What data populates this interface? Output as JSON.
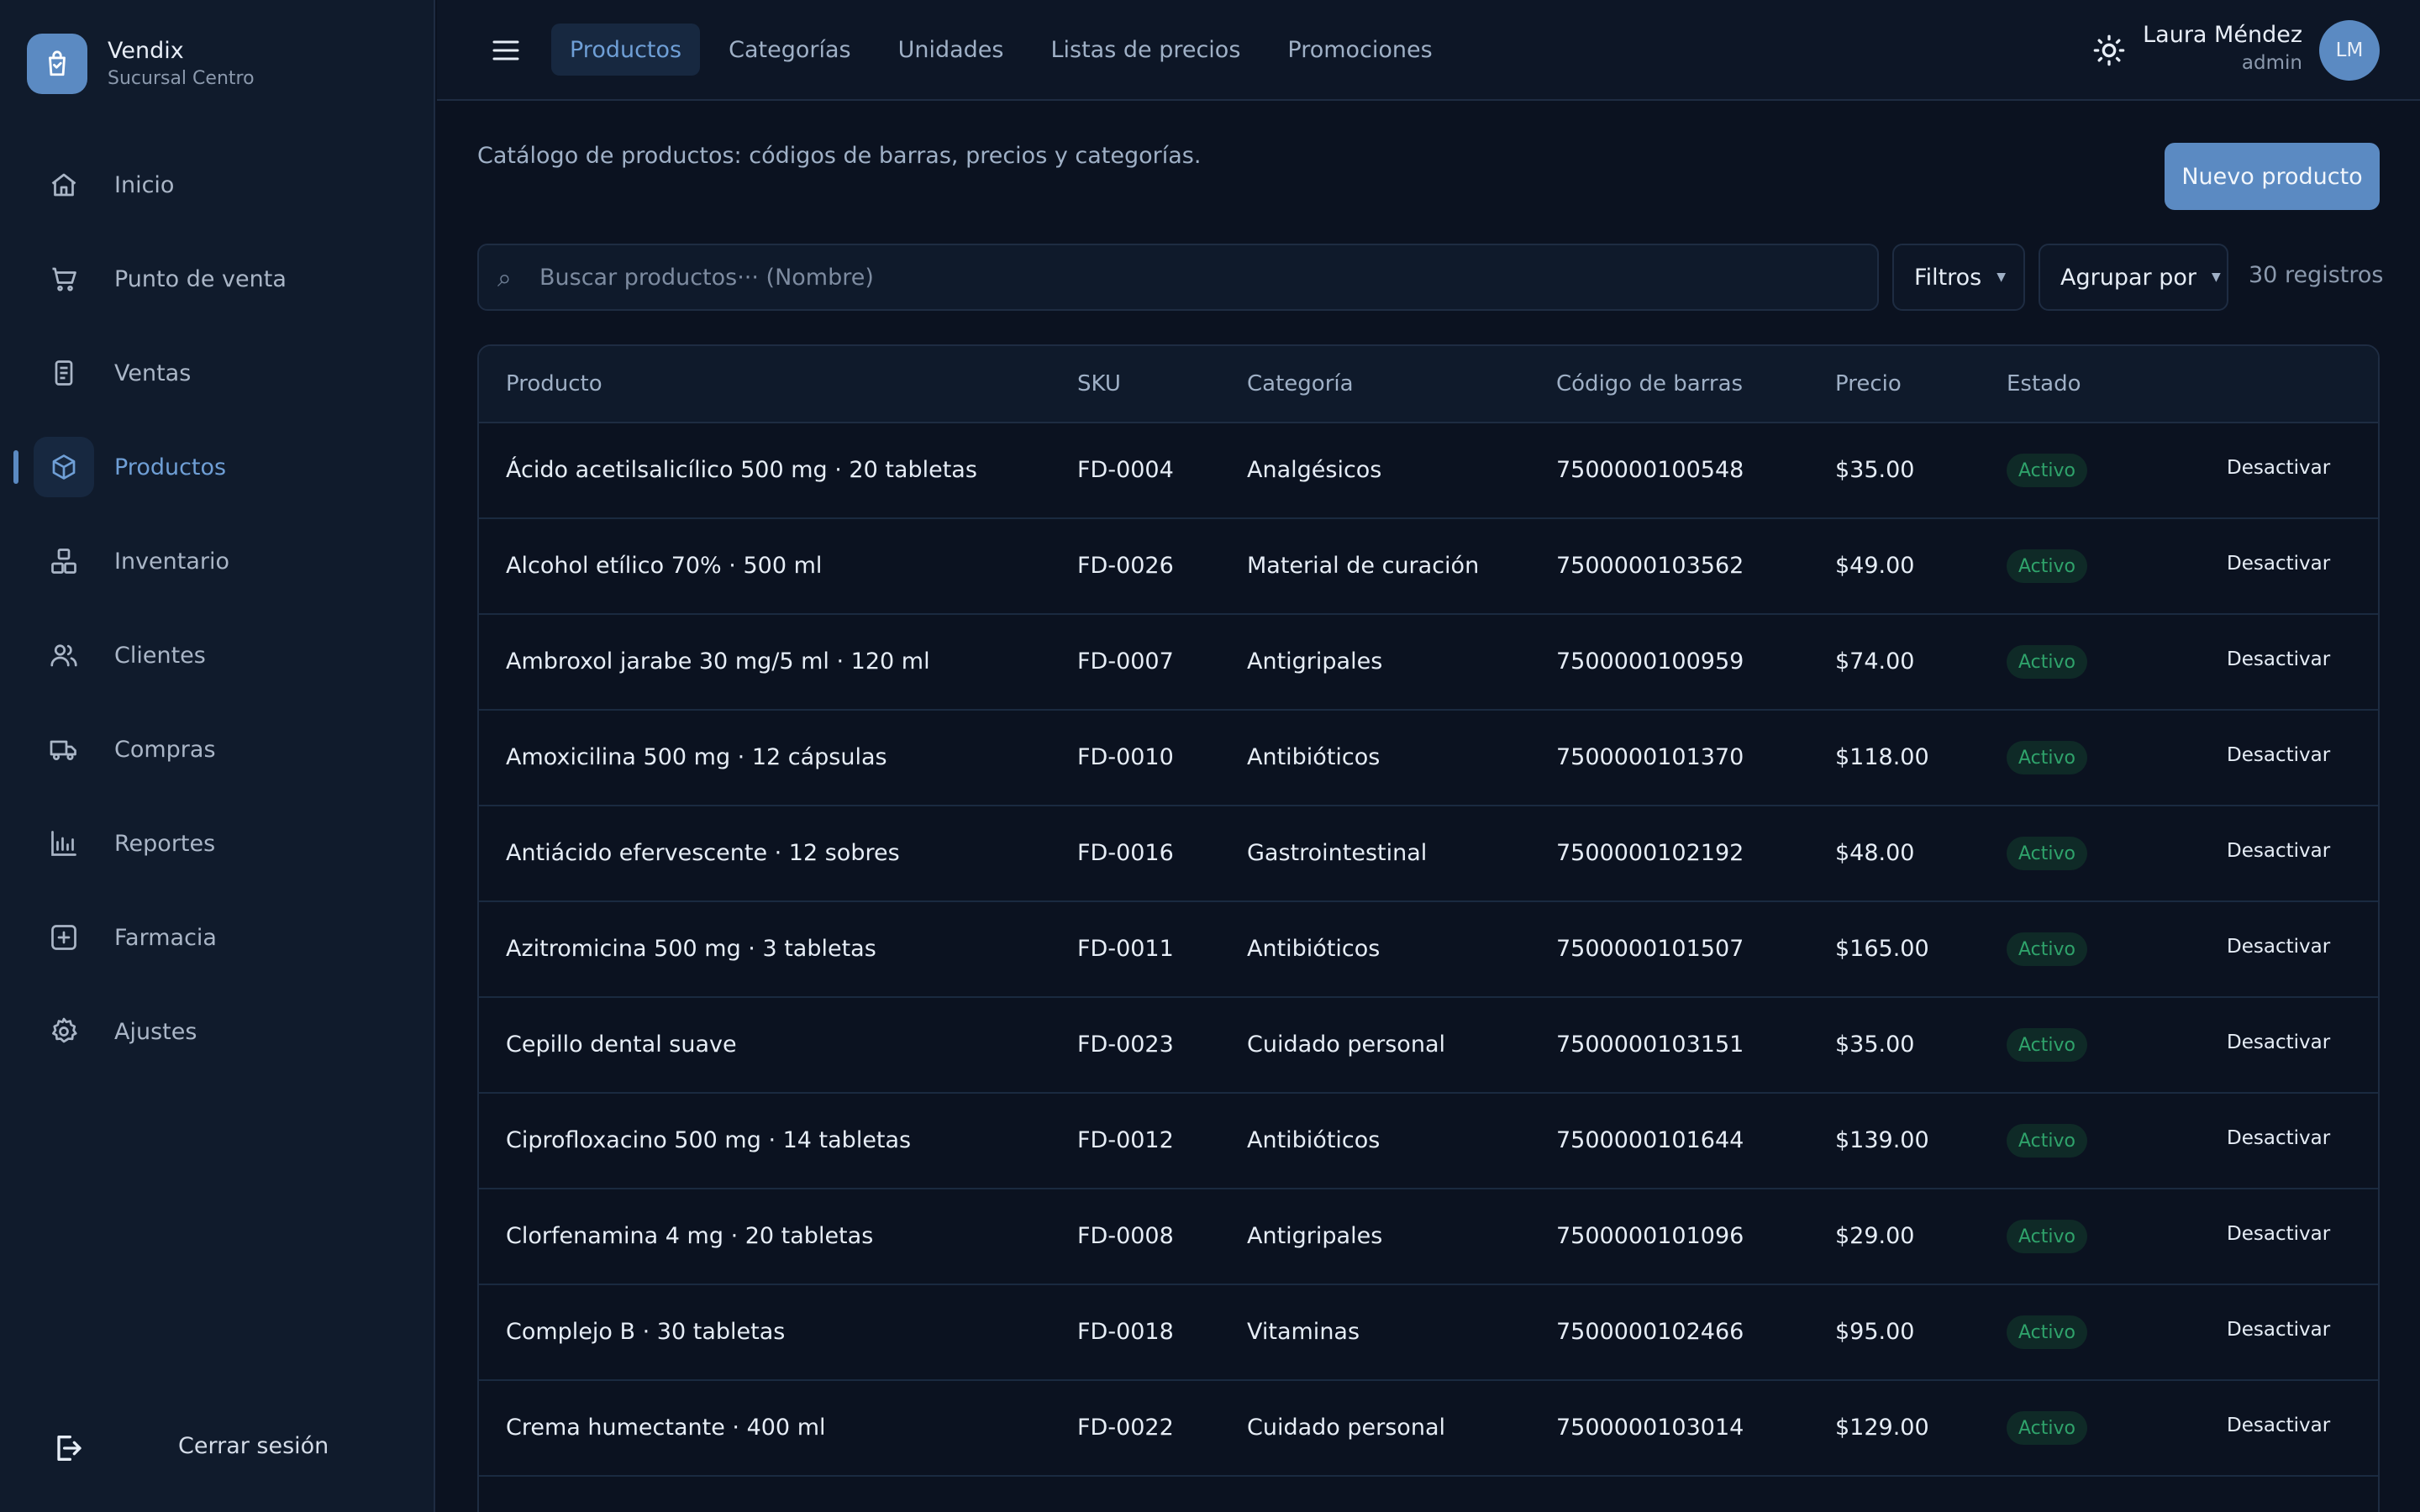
{
  "brand": {
    "name": "Vendix",
    "branch": "Sucursal Centro"
  },
  "sidebar": {
    "items": [
      {
        "label": "Inicio",
        "icon": "home-icon"
      },
      {
        "label": "Punto de venta",
        "icon": "cart-icon"
      },
      {
        "label": "Ventas",
        "icon": "receipt-icon"
      },
      {
        "label": "Productos",
        "icon": "box-icon",
        "active": true
      },
      {
        "label": "Inventario",
        "icon": "inventory-icon"
      },
      {
        "label": "Clientes",
        "icon": "users-icon"
      },
      {
        "label": "Compras",
        "icon": "truck-icon"
      },
      {
        "label": "Reportes",
        "icon": "chart-icon"
      },
      {
        "label": "Farmacia",
        "icon": "plus-square-icon"
      },
      {
        "label": "Ajustes",
        "icon": "gear-icon"
      }
    ],
    "logout_label": "Cerrar sesión"
  },
  "topbar": {
    "tabs": [
      "Productos",
      "Categorías",
      "Unidades",
      "Listas de precios",
      "Promociones"
    ],
    "active_tab": 0,
    "user": {
      "name": "Laura Méndez",
      "role": "admin",
      "initials": "LM"
    }
  },
  "main": {
    "description": "Catálogo de productos: códigos de barras, precios y categorías.",
    "new_button": "Nuevo producto",
    "search_placeholder": "Buscar productos··· (Nombre)",
    "filters_label": "Filtros",
    "groupby_label": "Agrupar por",
    "record_count": "30 registros"
  },
  "table": {
    "headers": [
      "Producto",
      "SKU",
      "Categoría",
      "Código de barras",
      "Precio",
      "Estado"
    ],
    "action_label": "Desactivar",
    "rows": [
      [
        "Ácido acetilsalicílico 500 mg · 20 tabletas",
        "FD-0004",
        "Analgésicos",
        "7500000100548",
        "$35.00",
        "Activo"
      ],
      [
        "Alcohol etílico 70% · 500 ml",
        "FD-0026",
        "Material de curación",
        "7500000103562",
        "$49.00",
        "Activo"
      ],
      [
        "Ambroxol jarabe 30 mg/5 ml · 120 ml",
        "FD-0007",
        "Antigripales",
        "7500000100959",
        "$74.00",
        "Activo"
      ],
      [
        "Amoxicilina 500 mg · 12 cápsulas",
        "FD-0010",
        "Antibióticos",
        "7500000101370",
        "$118.00",
        "Activo"
      ],
      [
        "Antiácido efervescente · 12 sobres",
        "FD-0016",
        "Gastrointestinal",
        "7500000102192",
        "$48.00",
        "Activo"
      ],
      [
        "Azitromicina 500 mg · 3 tabletas",
        "FD-0011",
        "Antibióticos",
        "7500000101507",
        "$165.00",
        "Activo"
      ],
      [
        "Cepillo dental suave",
        "FD-0023",
        "Cuidado personal",
        "7500000103151",
        "$35.00",
        "Activo"
      ],
      [
        "Ciprofloxacino 500 mg · 14 tabletas",
        "FD-0012",
        "Antibióticos",
        "7500000101644",
        "$139.00",
        "Activo"
      ],
      [
        "Clorfenamina 4 mg · 20 tabletas",
        "FD-0008",
        "Antigripales",
        "7500000101096",
        "$29.00",
        "Activo"
      ],
      [
        "Complejo B · 30 tabletas",
        "FD-0018",
        "Vitaminas",
        "7500000102466",
        "$95.00",
        "Activo"
      ],
      [
        "Crema humectante · 400 ml",
        "FD-0022",
        "Cuidado personal",
        "7500000103014",
        "$129.00",
        "Activo"
      ]
    ]
  },
  "colors": {
    "accent": "#5b8ac2",
    "active_text": "#6f9fd6",
    "status_active": "#2fa36b",
    "background": "#0b1220",
    "sidebar": "#101b2c"
  }
}
